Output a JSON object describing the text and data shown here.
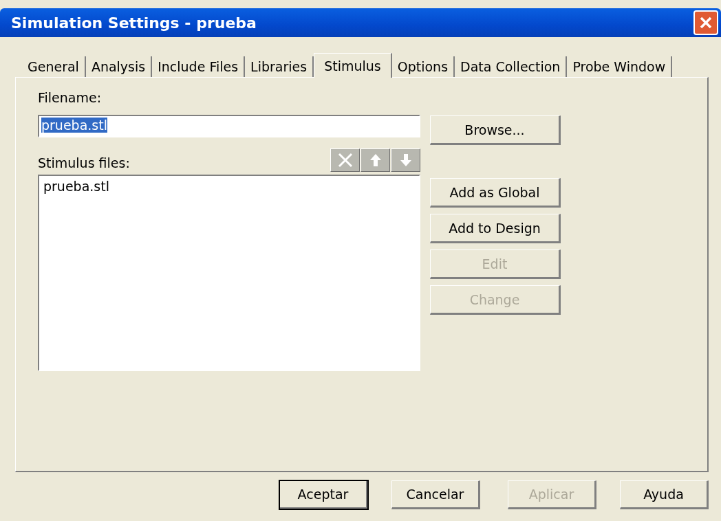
{
  "window": {
    "title": "Simulation Settings - prueba"
  },
  "tabs": [
    {
      "label": "General",
      "selected": false
    },
    {
      "label": "Analysis",
      "selected": false
    },
    {
      "label": "Include Files",
      "selected": false
    },
    {
      "label": "Libraries",
      "selected": false
    },
    {
      "label": "Stimulus",
      "selected": true
    },
    {
      "label": "Options",
      "selected": false
    },
    {
      "label": "Data Collection",
      "selected": false
    },
    {
      "label": "Probe Window",
      "selected": false
    }
  ],
  "filename": {
    "label": "Filename:",
    "value": "prueba.stl",
    "text_selected": true
  },
  "browse_button": {
    "label": "Browse...",
    "disabled": false
  },
  "stimulus_files": {
    "label": "Stimulus files:",
    "items": [
      "prueba.stl"
    ]
  },
  "list_tools": [
    {
      "kind": "delete",
      "disabled": true
    },
    {
      "kind": "up",
      "disabled": true
    },
    {
      "kind": "down",
      "disabled": true
    }
  ],
  "side_buttons": [
    {
      "label": "Add as Global",
      "disabled": false
    },
    {
      "label": "Add to Design",
      "disabled": false
    },
    {
      "label": "Edit",
      "disabled": true
    },
    {
      "label": "Change",
      "disabled": true
    }
  ],
  "footer_buttons": [
    {
      "label": "Aceptar",
      "default": true,
      "disabled": false
    },
    {
      "label": "Cancelar",
      "default": false,
      "disabled": false
    },
    {
      "label": "Aplicar",
      "default": false,
      "disabled": true
    },
    {
      "label": "Ayuda",
      "default": false,
      "disabled": false
    }
  ]
}
